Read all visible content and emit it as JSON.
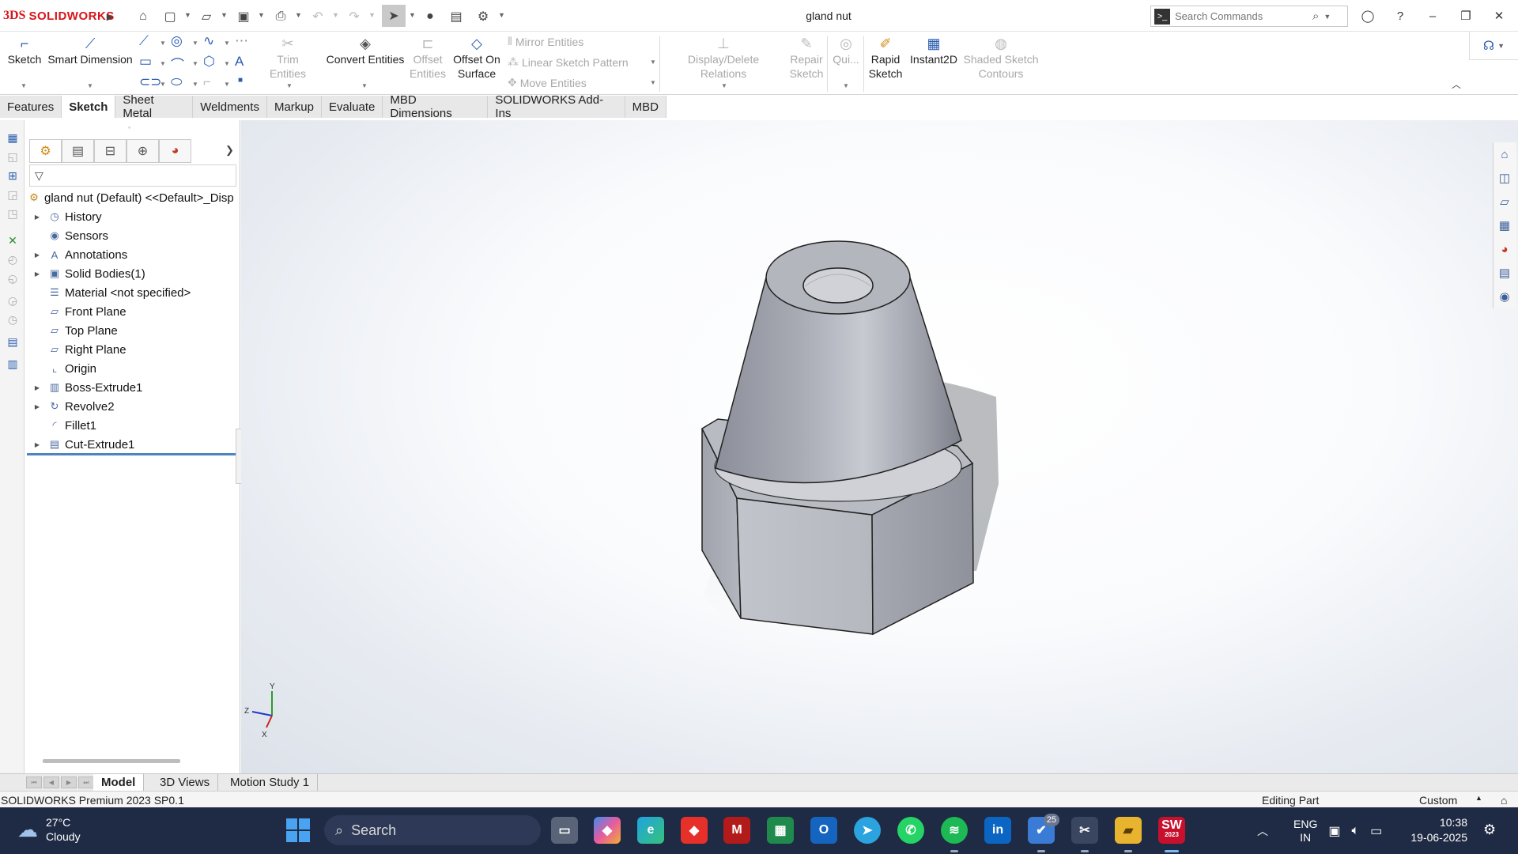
{
  "app": {
    "brand_ds": "3DS",
    "brand_name": "SOLIDWORKS",
    "document_title": "gland nut"
  },
  "search": {
    "placeholder": "Search Commands"
  },
  "ribbon": {
    "sketch": "Sketch",
    "smart_dimension": "Smart Dimension",
    "trim_entities": "Trim Entities",
    "convert_entities": "Convert Entities",
    "offset_entities": "Offset Entities",
    "offset_on_surface": "Offset On Surface",
    "mirror_entities": "Mirror Entities",
    "linear_sketch_pattern": "Linear Sketch Pattern",
    "move_entities": "Move Entities",
    "display_delete_relations": "Display/Delete Relations",
    "repair_sketch": "Repair Sketch",
    "quick_snaps": "Qui...",
    "rapid_sketch": "Rapid Sketch",
    "instant2d": "Instant2D",
    "shaded_sketch_contours": "Shaded Sketch Contours"
  },
  "tabs": [
    "Features",
    "Sketch",
    "Sheet Metal",
    "Weldments",
    "Markup",
    "Evaluate",
    "MBD Dimensions",
    "SOLIDWORKS Add-Ins",
    "MBD"
  ],
  "active_tab": "Sketch",
  "tree": {
    "root": "gland nut (Default) <<Default>_Disp",
    "items": [
      {
        "label": "History",
        "icon": "history-icon",
        "expandable": true
      },
      {
        "label": "Sensors",
        "icon": "sensors-icon",
        "expandable": false
      },
      {
        "label": "Annotations",
        "icon": "annotations-icon",
        "expandable": true
      },
      {
        "label": "Solid Bodies(1)",
        "icon": "solid-bodies-icon",
        "expandable": true
      },
      {
        "label": "Material <not specified>",
        "icon": "material-icon",
        "expandable": false
      },
      {
        "label": "Front Plane",
        "icon": "plane-icon",
        "expandable": false
      },
      {
        "label": "Top Plane",
        "icon": "plane-icon",
        "expandable": false
      },
      {
        "label": "Right Plane",
        "icon": "plane-icon",
        "expandable": false
      },
      {
        "label": "Origin",
        "icon": "origin-icon",
        "expandable": false
      },
      {
        "label": "Boss-Extrude1",
        "icon": "boss-extrude-icon",
        "expandable": true
      },
      {
        "label": "Revolve2",
        "icon": "revolve-icon",
        "expandable": true
      },
      {
        "label": "Fillet1",
        "icon": "fillet-icon",
        "expandable": false
      },
      {
        "label": "Cut-Extrude1",
        "icon": "cut-extrude-icon",
        "expandable": true
      }
    ]
  },
  "triad": {
    "x": "X",
    "y": "Y",
    "z": "Z"
  },
  "bottom_tabs": [
    "Model",
    "3D Views",
    "Motion Study 1"
  ],
  "status": {
    "version": "SOLIDWORKS Premium 2023 SP0.1",
    "mode": "Editing Part",
    "units": "Custom"
  },
  "taskbar": {
    "temp": "27°C",
    "weather": "Cloudy",
    "search": "Search",
    "lang_1": "ENG",
    "lang_2": "IN",
    "time": "10:38",
    "date": "19-06-2025",
    "badge": "25",
    "sw_badge": "SW",
    "sw_year": "2023"
  },
  "colors": {
    "accent": "#2a5db0",
    "brand": "#d7141a",
    "taskbar": "#1f2a44",
    "rollback": "#4e83c4"
  }
}
